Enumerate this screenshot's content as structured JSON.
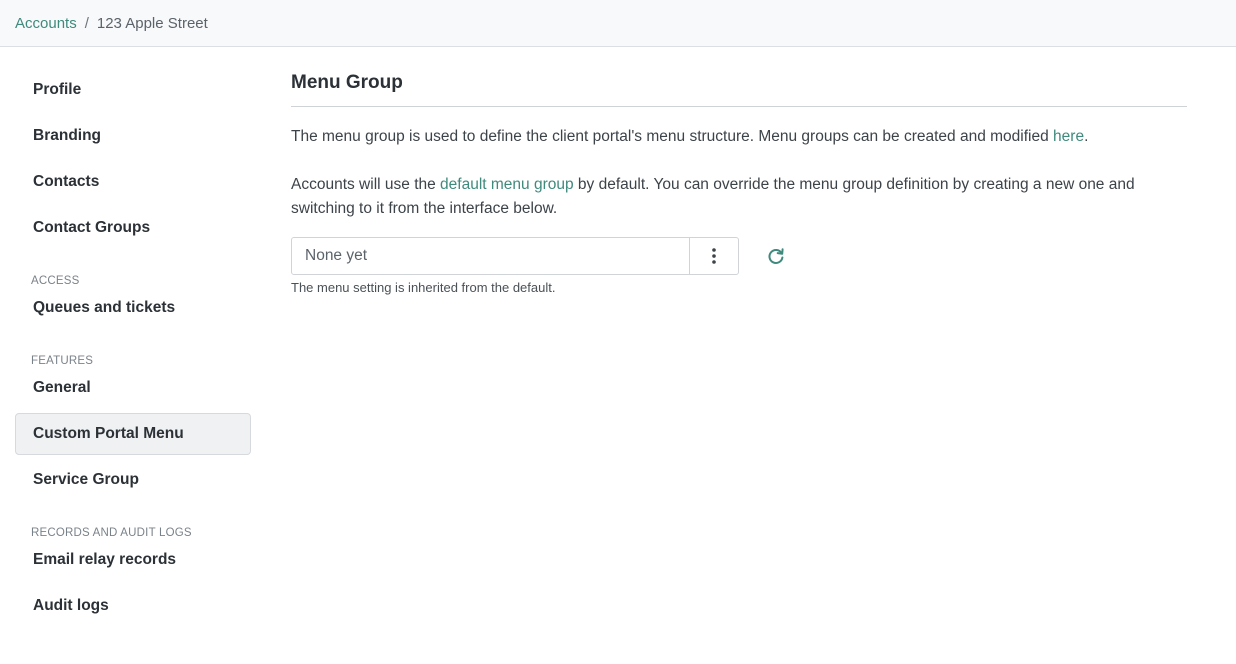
{
  "breadcrumb": {
    "parent": "Accounts",
    "separator": "/",
    "current": "123 Apple Street"
  },
  "sidebar": {
    "items_top": [
      {
        "label": "Profile"
      },
      {
        "label": "Branding"
      },
      {
        "label": "Contacts"
      },
      {
        "label": "Contact Groups"
      }
    ],
    "section_access": "ACCESS",
    "items_access": [
      {
        "label": "Queues and tickets"
      }
    ],
    "section_features": "FEATURES",
    "items_features": [
      {
        "label": "General"
      },
      {
        "label": "Custom Portal Menu",
        "active": true
      },
      {
        "label": "Service Group"
      }
    ],
    "section_records": "RECORDS AND AUDIT LOGS",
    "items_records": [
      {
        "label": "Email relay records"
      },
      {
        "label": "Audit logs"
      }
    ]
  },
  "main": {
    "title": "Menu Group",
    "para1_text": "The menu group is used to define the client portal's menu structure. Menu groups can be created and modified ",
    "para1_link": "here",
    "para1_end": ".",
    "para2_start": "Accounts will use the ",
    "para2_link": "default menu group",
    "para2_end": " by default. You can override the menu group definition by creating a new one and switching to it from the interface below.",
    "select_value": "None yet",
    "helper_text": "The menu setting is inherited from the default."
  },
  "colors": {
    "accent": "#3f8a7c",
    "active_bg": "#f0f1f3"
  },
  "icons": {
    "menu": "vertical-dots-icon",
    "refresh": "refresh-icon"
  }
}
